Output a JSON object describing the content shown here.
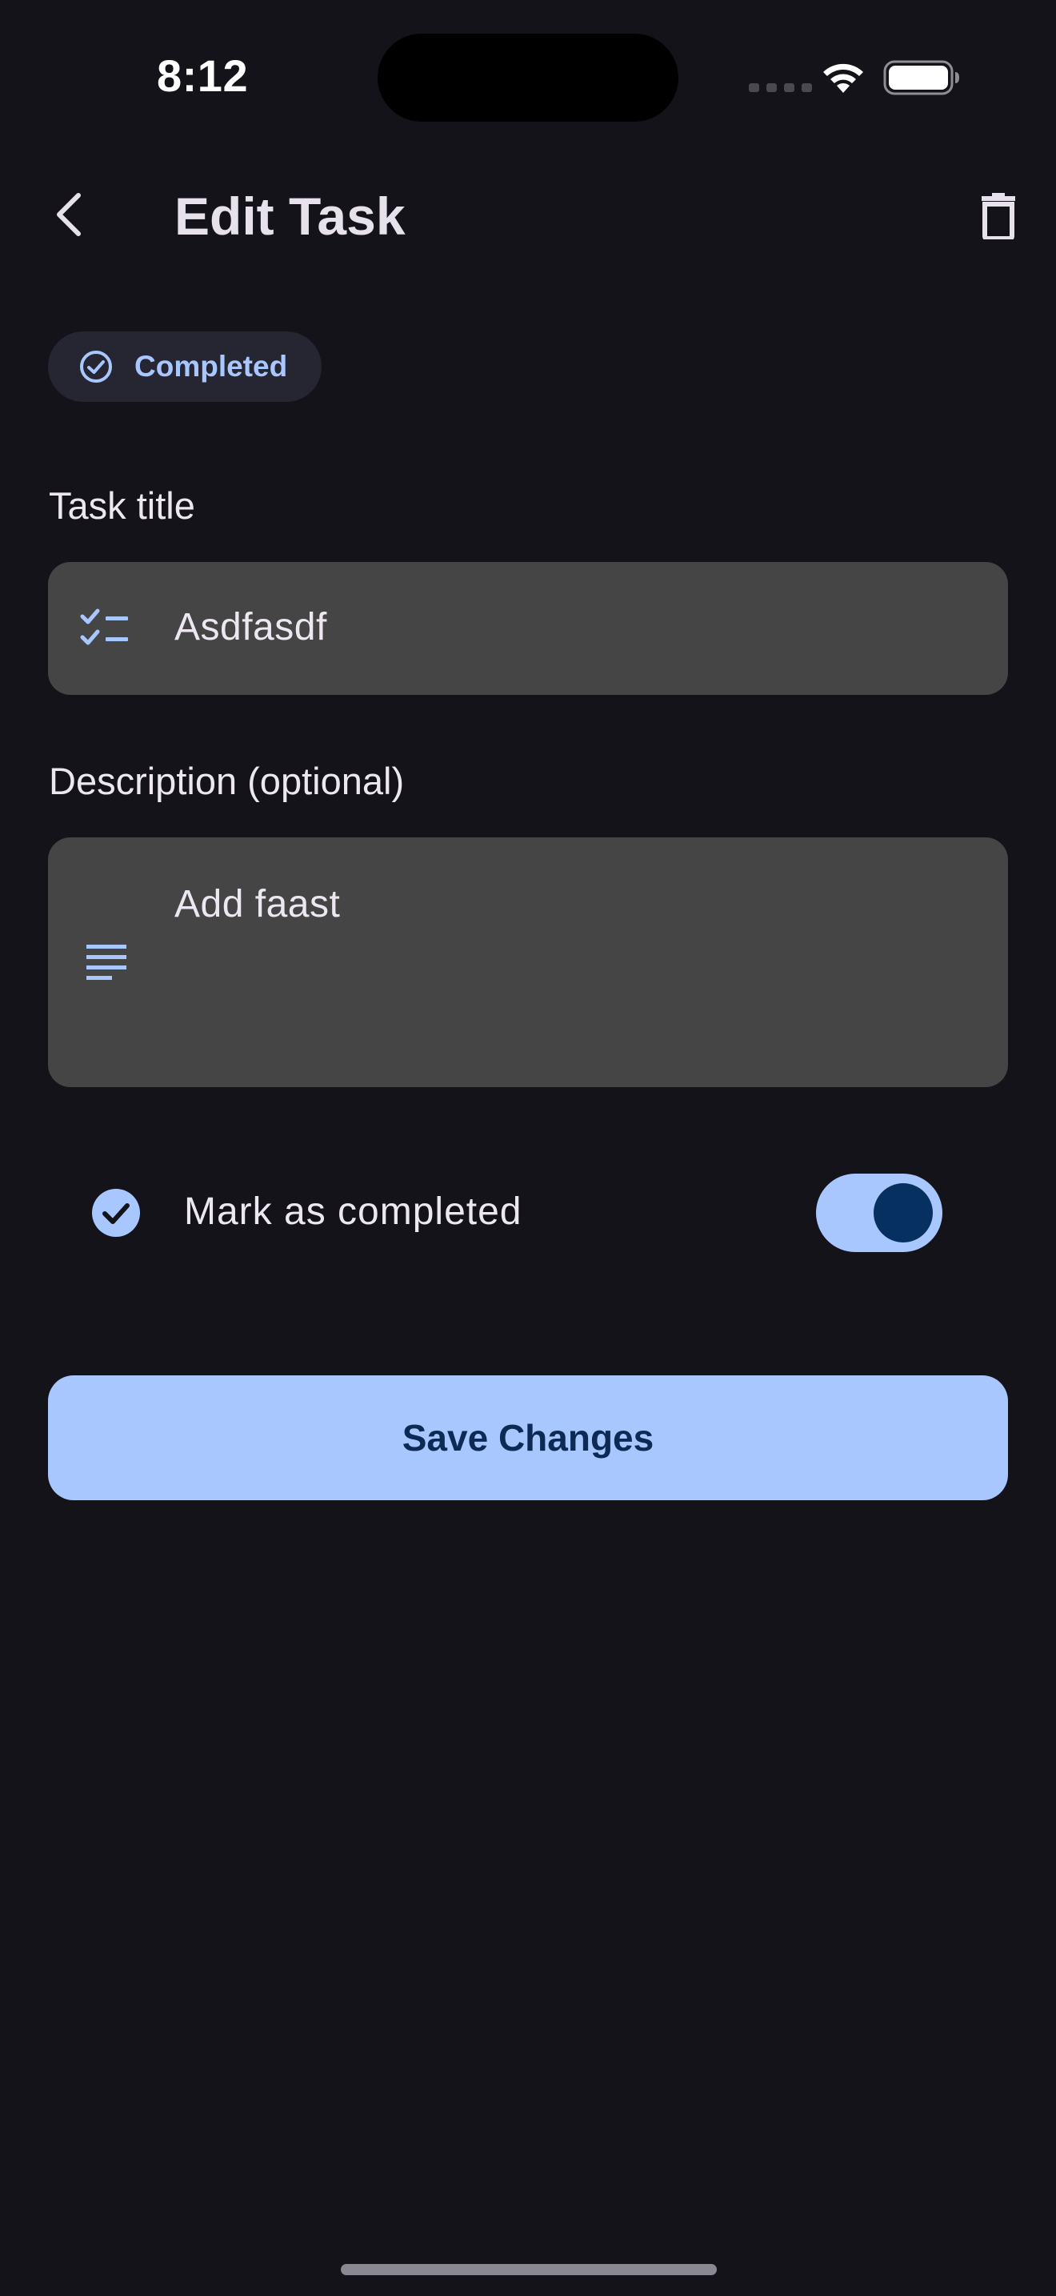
{
  "status_bar": {
    "time": "8:12"
  },
  "app_bar": {
    "title": "Edit Task",
    "back_icon": "chevron-left-icon",
    "delete_icon": "trash-icon"
  },
  "status_chip": {
    "label": "Completed",
    "icon": "check-circle-outline-icon"
  },
  "title_field": {
    "label": "Task title",
    "value": "Asdfasdf",
    "icon": "checklist-icon"
  },
  "description_field": {
    "label": "Description (optional)",
    "value": "Add faast",
    "icon": "notes-lines-icon"
  },
  "completion": {
    "label": "Mark as completed",
    "checked": true,
    "icon": "check-circle-filled-icon"
  },
  "actions": {
    "save_label": "Save Changes"
  },
  "colors": {
    "background": "#15131a",
    "accent": "#a9c7ff",
    "accent_dark": "#06305f",
    "field_background": "#454545",
    "chip_background": "#252631"
  }
}
